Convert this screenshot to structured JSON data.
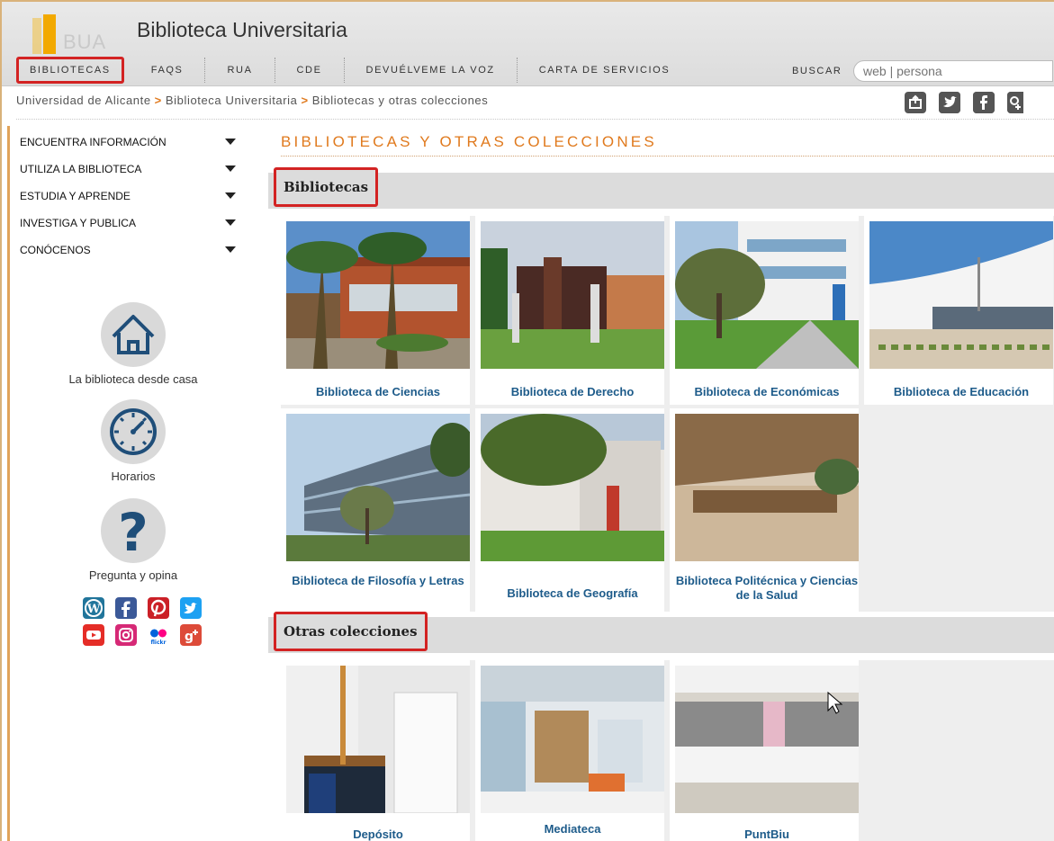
{
  "header": {
    "logo_text": "BUA",
    "site_title": "Biblioteca Universitaria",
    "nav": [
      "BIBLIOTECAS",
      "FAQS",
      "RUA",
      "CDE",
      "DEVUÉLVEME LA VOZ",
      "CARTA DE SERVICIOS"
    ],
    "search_label": "BUSCAR",
    "search_placeholder": "web | persona"
  },
  "breadcrumb": {
    "items": [
      "Universidad de Alicante",
      "Biblioteca Universitaria",
      "Bibliotecas y otras colecciones"
    ],
    "separator": ">"
  },
  "sidebar": {
    "menu": [
      "ENCUENTRA INFORMACIÓN",
      "UTILIZA LA BIBLIOTECA",
      "ESTUDIA Y APRENDE",
      "INVESTIGA Y PUBLICA",
      "CONÓCENOS"
    ],
    "tools": [
      "La biblioteca desde casa",
      "Horarios",
      "Pregunta y opina"
    ]
  },
  "main": {
    "page_title": "BIBLIOTECAS Y OTRAS COLECCIONES",
    "section_bibliotecas": "Bibliotecas",
    "bibliotecas": [
      "Biblioteca de Ciencias",
      "Biblioteca de Derecho",
      "Biblioteca de Económicas",
      "Biblioteca de Educación",
      "Biblioteca de Filosofía y Letras",
      "Biblioteca de Geografía",
      "Biblioteca Politécnica y Ciencias de la Salud"
    ],
    "section_otras": "Otras colecciones",
    "otras": [
      "Depósito",
      "Mediateca",
      "PuntBiu"
    ]
  },
  "colors": {
    "accent_orange": "#e07a1e",
    "highlight_red": "#d32323",
    "link_blue": "#1d5b8a"
  }
}
